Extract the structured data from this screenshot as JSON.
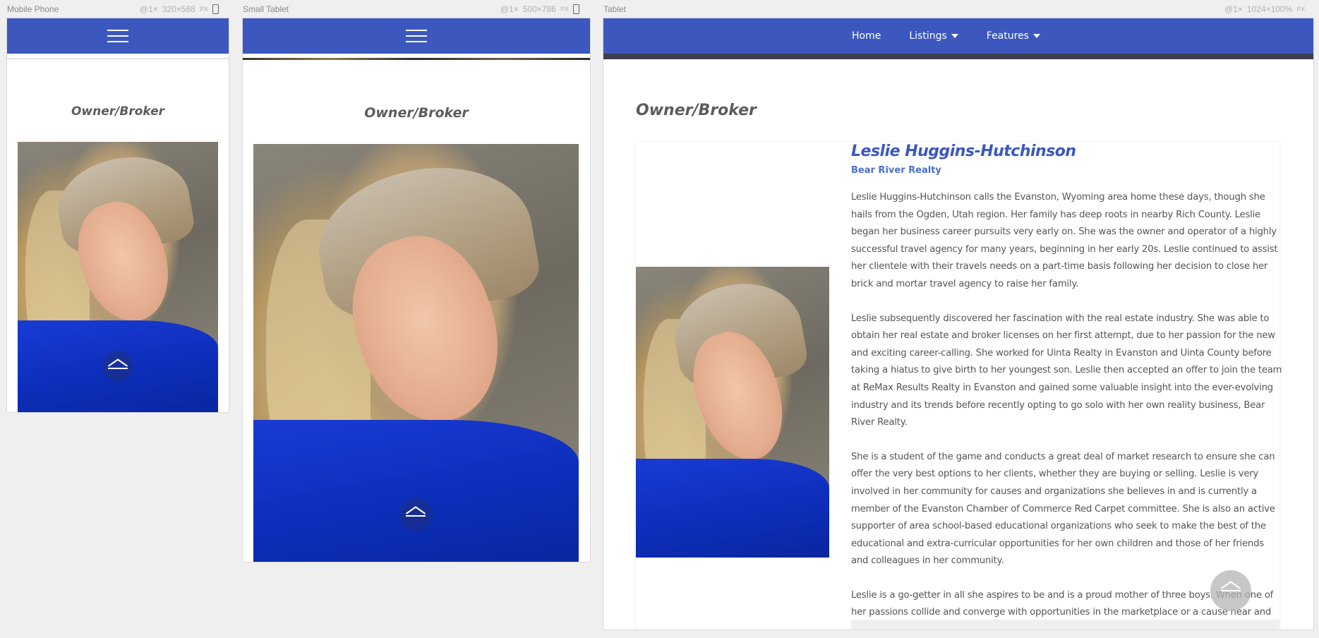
{
  "frames": {
    "mobile": {
      "label": "Mobile Phone",
      "scale": "@1×",
      "size": "320×568",
      "unit": "PX"
    },
    "small_tablet": {
      "label": "Small Tablet",
      "scale": "@1×",
      "size": "500×786",
      "unit": "PX"
    },
    "tablet": {
      "label": "Tablet",
      "scale": "@1×",
      "size": "1024×100%",
      "unit": "PX"
    }
  },
  "section_title": "Owner/Broker",
  "nav": {
    "home": "Home",
    "listings": "Listings",
    "features": "Features"
  },
  "bio": {
    "name": "Leslie Huggins-Hutchinson",
    "company": "Bear River Realty",
    "paragraphs": [
      "Leslie Huggins-Hutchinson calls the Evanston, Wyoming area home these days, though she hails from the Ogden, Utah region. Her family has deep roots in nearby Rich County. Leslie began her business career pursuits very early on. She was the owner and operator of a highly successful travel agency for many years, beginning in her early 20s. Leslie continued to assist her clientele with their travels needs on a part-time basis following her decision to close her brick and mortar travel agency to raise her family.",
      "Leslie subsequently discovered her fascination with the real estate industry. She was able to obtain her real estate and broker licenses on her first attempt, due to her passion for the new and exciting career-calling. She worked for Uinta Realty in Evanston and Uinta County before taking a hiatus to give birth to her youngest son. Leslie then accepted an offer to join the team at ReMax Results Realty in Evanston and gained some valuable insight into the ever-evolving industry and its trends before recently opting to go solo with her own reality business, Bear River Realty.",
      "She is a student of the game and conducts a great deal of market research to ensure she can offer the very best options to her clients, whether they are buying or selling. Leslie is very involved in her community for causes and organizations she believes in and is currently a member of the Evanston Chamber of Commerce Red Carpet committee. She is also an active supporter of area school-based educational organizations who seek to make the best of the educational and extra-curricular opportunities for her own children and those of her friends and colleagues in her community.",
      "Leslie is a go-getter in all she aspires to be and is a proud mother of three boys. When one of her passions collide and converge with opportunities in the marketplace or a cause near and dear to her, expect a successful outcome."
    ]
  },
  "icons": {
    "menu": "hamburger-menu-icon",
    "scroll_up": "chevron-up-icon",
    "device": "phone-device-icon"
  },
  "colors": {
    "navbar": "#3c58bf",
    "name": "#3c58bf",
    "company": "#4a6fd0",
    "body_text": "#555555",
    "title": "#5c5c5c"
  }
}
